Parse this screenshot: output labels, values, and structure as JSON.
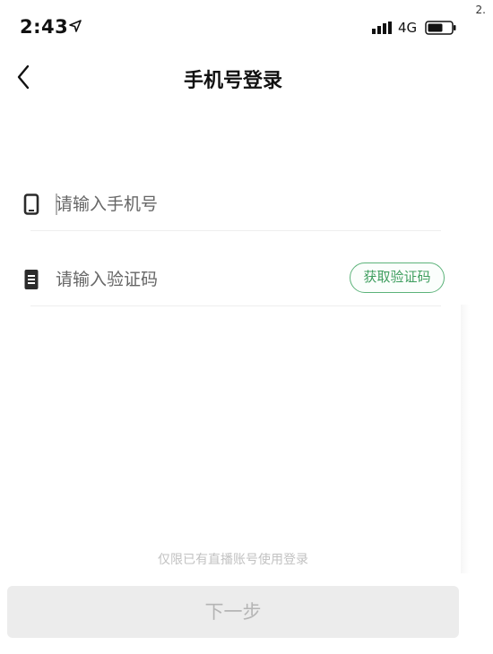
{
  "status_bar": {
    "time": "2:43",
    "network": "4G",
    "corner_mark": "2."
  },
  "nav": {
    "title": "手机号登录",
    "back_icon": "chevron-left-icon"
  },
  "form": {
    "phone": {
      "placeholder": "请输入手机号",
      "value": "",
      "icon": "phone-icon"
    },
    "code": {
      "placeholder": "请输入验证码",
      "value": "",
      "icon": "document-icon",
      "get_code_label": "获取验证码"
    }
  },
  "footer": {
    "hint": "仅限已有直播账号使用登录",
    "next_label": "下一步"
  },
  "colors": {
    "accent_green": "#3f9e5f",
    "disabled_button_bg": "#ececec",
    "disabled_text": "#b5b5b5"
  }
}
